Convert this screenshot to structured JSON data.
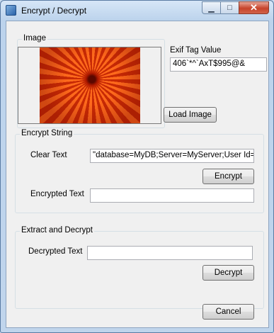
{
  "window": {
    "title": "Encrypt / Decrypt",
    "minimize_glyph": "▁",
    "maximize_glyph": "□",
    "close_glyph": "✕"
  },
  "image_group": {
    "label": "Image",
    "image_icon": "flower-photo"
  },
  "exif": {
    "label": "Exif Tag Value",
    "value": "406`*^`AxT$995@&"
  },
  "load_image_button": "Load Image",
  "encrypt_group": {
    "label": "Encrypt String",
    "clear_text_label": "Clear Text",
    "clear_text_value": "\"database=MyDB;Server=MyServer;User Id=root",
    "encrypt_button": "Encrypt",
    "encrypted_text_label": "Encrypted Text",
    "encrypted_text_value": ""
  },
  "decrypt_group": {
    "label": "Extract and Decrypt",
    "decrypted_text_label": "Decrypted Text",
    "decrypted_text_value": "",
    "decrypt_button": "Decrypt"
  },
  "cancel_button": "Cancel"
}
